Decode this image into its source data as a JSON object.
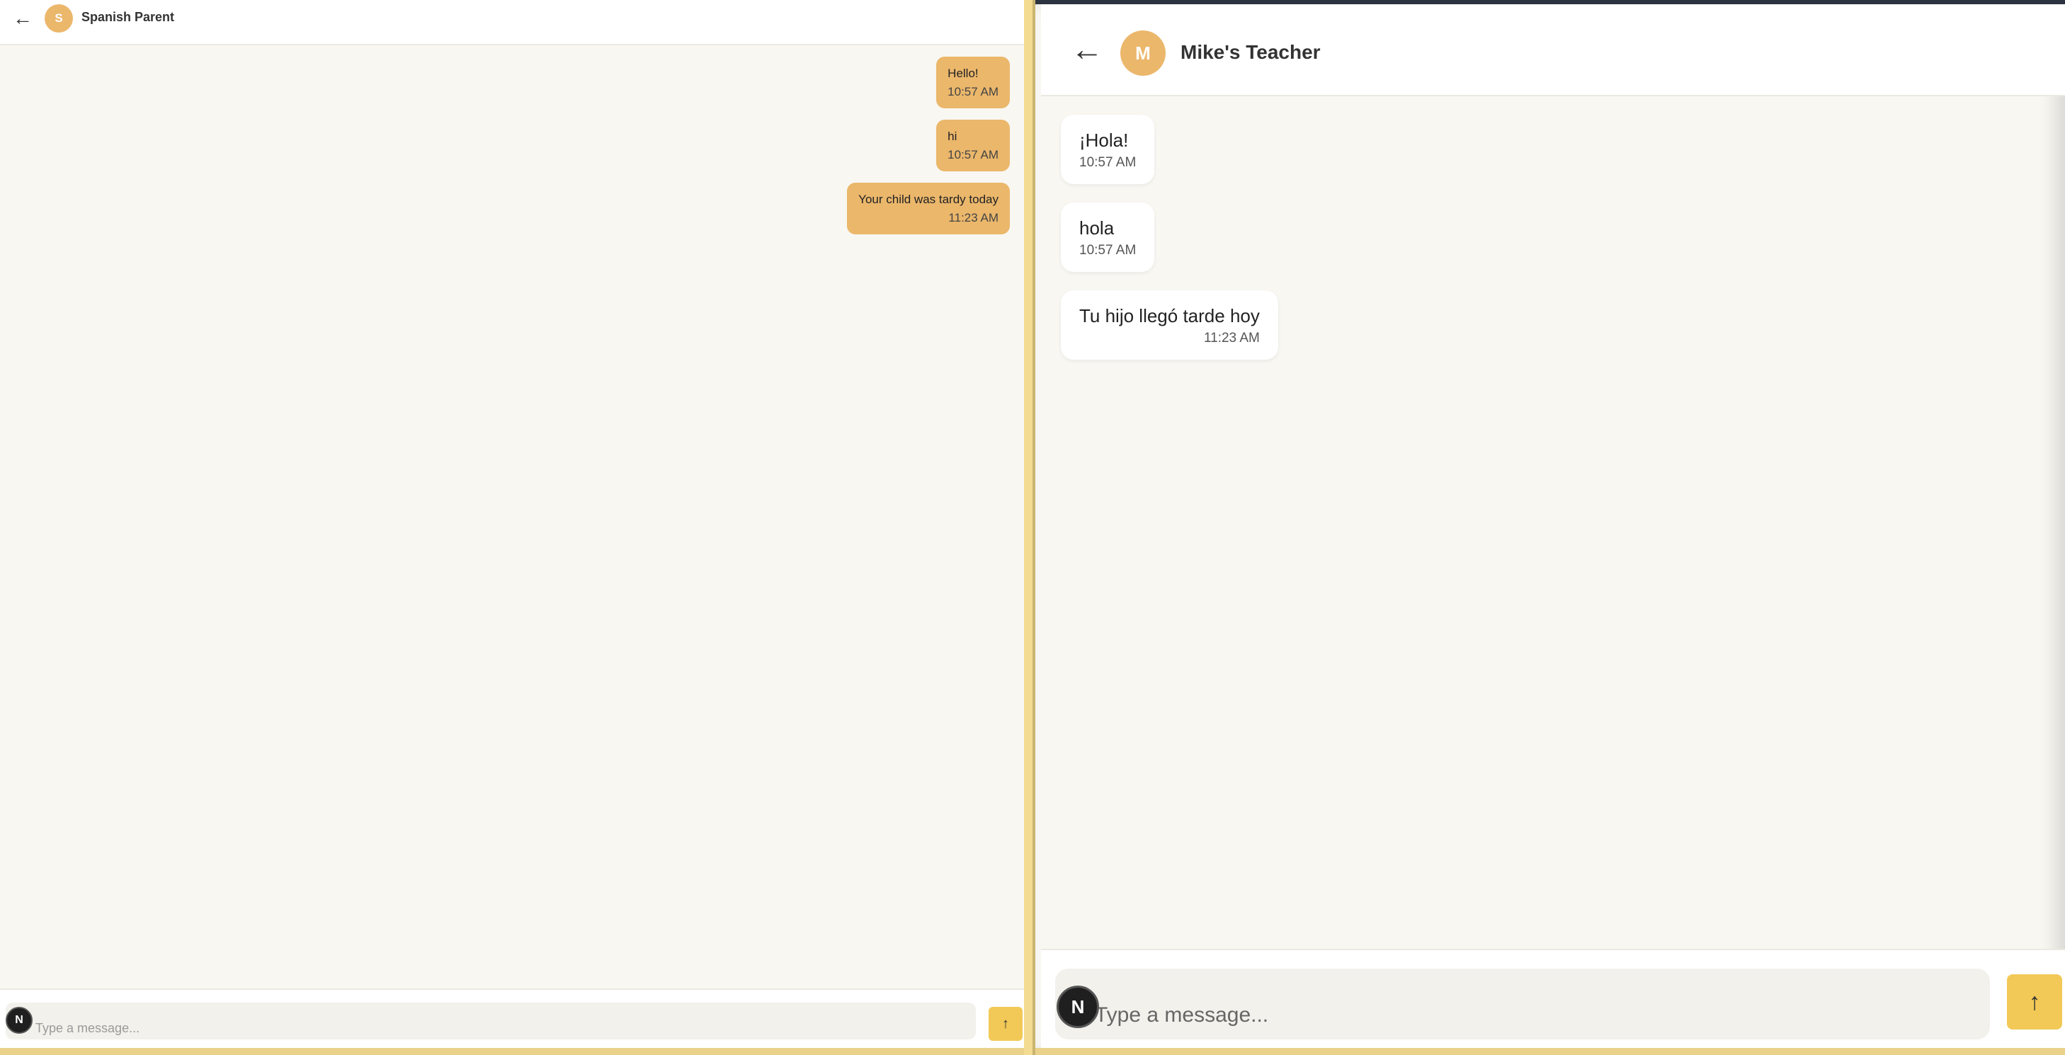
{
  "left_pane": {
    "header": {
      "back_icon": "←",
      "avatar_initial": "S",
      "contact_name": "Spanish Parent"
    },
    "messages": [
      {
        "text": "Hello!",
        "time": "10:57 AM"
      },
      {
        "text": "hi",
        "time": "10:57 AM"
      },
      {
        "text": "Your child was tardy today",
        "time": "11:23 AM"
      }
    ],
    "composer": {
      "placeholder": "Type a message...",
      "badge": "N",
      "send_icon": "↑"
    }
  },
  "right_pane": {
    "header": {
      "back_icon": "←",
      "avatar_initial": "M",
      "contact_name": "Mike's Teacher"
    },
    "messages": [
      {
        "text": "¡Hola!",
        "time": "10:57 AM"
      },
      {
        "text": "hola",
        "time": "10:57 AM"
      },
      {
        "text": "Tu hijo llegó tarde hoy",
        "time": "11:23 AM"
      }
    ],
    "composer": {
      "placeholder": "Type a message...",
      "badge": "N",
      "send_icon": "↑"
    }
  },
  "colors": {
    "accent": "#ebb76b",
    "send_button": "#f2c957",
    "background": "#f8f7f2",
    "header_bar": "#2b3340"
  }
}
